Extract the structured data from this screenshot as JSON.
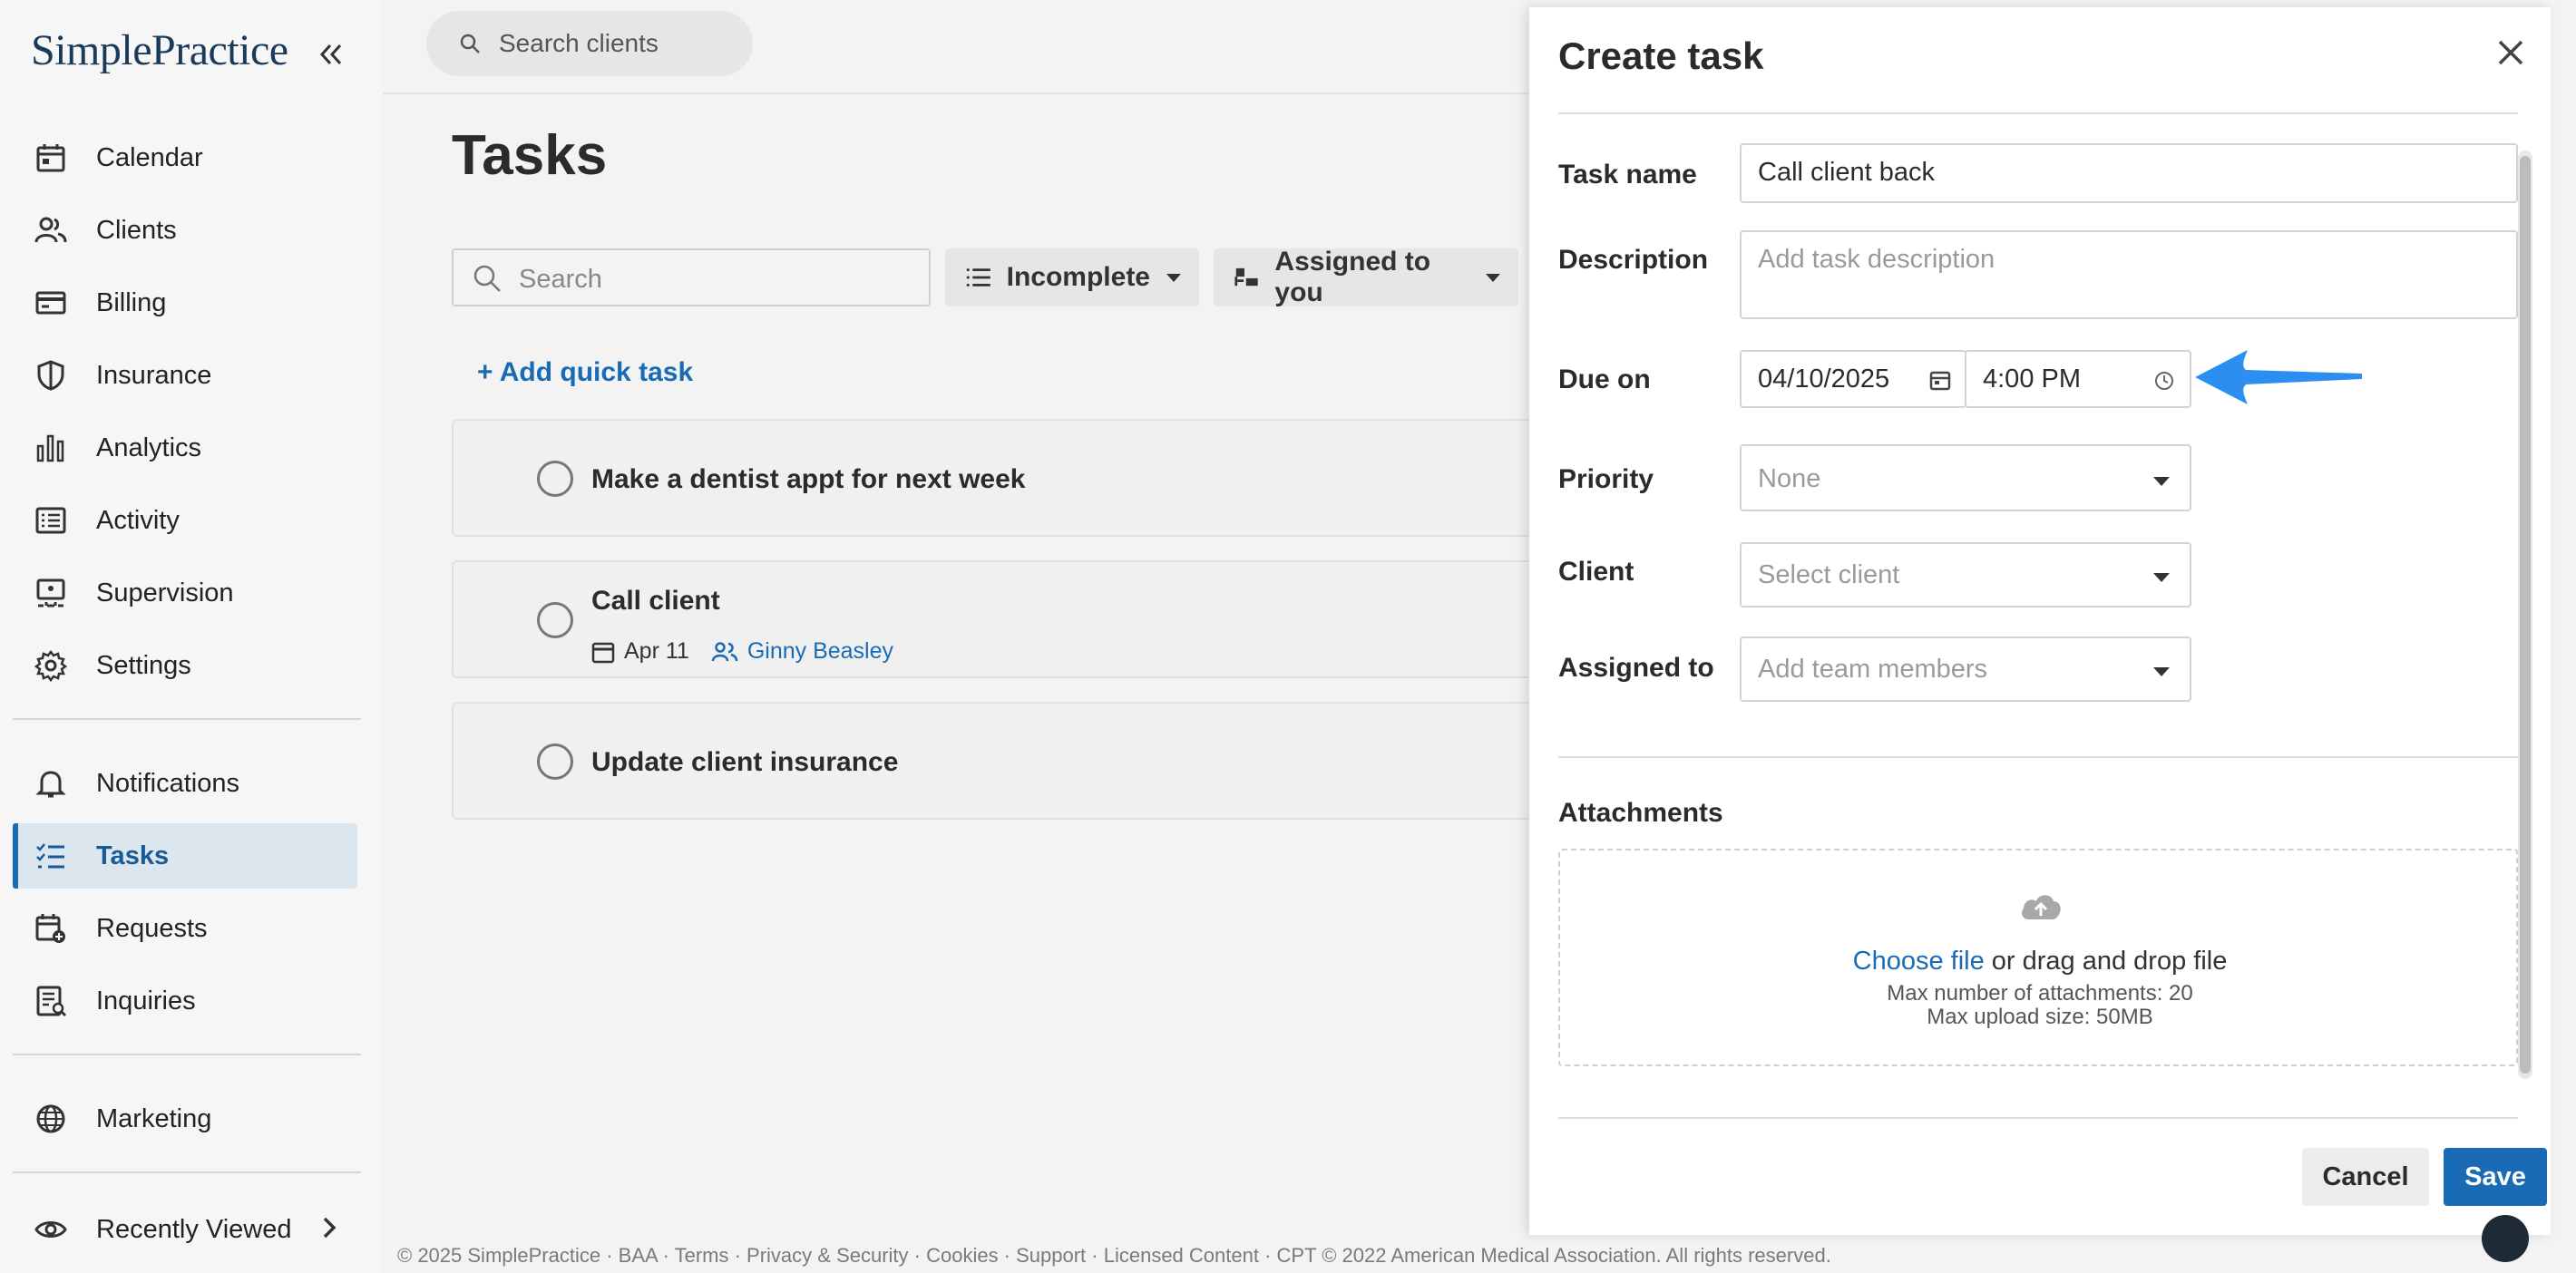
{
  "app": {
    "logo_text": "SimplePractice"
  },
  "sidebar": {
    "items": [
      {
        "label": "Calendar",
        "icon": "calendar-icon"
      },
      {
        "label": "Clients",
        "icon": "clients-icon"
      },
      {
        "label": "Billing",
        "icon": "billing-icon"
      },
      {
        "label": "Insurance",
        "icon": "shield-icon"
      },
      {
        "label": "Analytics",
        "icon": "analytics-icon"
      },
      {
        "label": "Activity",
        "icon": "activity-icon"
      },
      {
        "label": "Supervision",
        "icon": "supervision-icon"
      },
      {
        "label": "Settings",
        "icon": "gear-icon"
      },
      {
        "label": "Notifications",
        "icon": "bell-icon"
      },
      {
        "label": "Tasks",
        "icon": "tasks-icon",
        "active": true
      },
      {
        "label": "Requests",
        "icon": "requests-icon"
      },
      {
        "label": "Inquiries",
        "icon": "inquiries-icon"
      },
      {
        "label": "Marketing",
        "icon": "globe-icon"
      },
      {
        "label": "Recently Viewed",
        "icon": "eye-icon"
      }
    ]
  },
  "topbar": {
    "search_placeholder": "Search clients"
  },
  "tasks_page": {
    "title": "Tasks",
    "search_placeholder": "Search",
    "filter_status": "Incomplete",
    "filter_assignee": "Assigned to you",
    "add_quick_task": "+ Add quick task",
    "tasks": [
      {
        "title": "Make a dentist appt for next week"
      },
      {
        "title": "Call client",
        "due": "Apr 11",
        "client": "Ginny Beasley"
      },
      {
        "title": "Update client insurance"
      }
    ]
  },
  "create_task": {
    "title": "Create task",
    "task_name_label": "Task name",
    "task_name_value": "Call client back",
    "description_label": "Description",
    "description_placeholder": "Add task description",
    "due_on_label": "Due on",
    "due_date": "04/10/2025",
    "due_time": "4:00 PM",
    "priority_label": "Priority",
    "priority_value": "None",
    "client_label": "Client",
    "client_placeholder": "Select client",
    "assigned_label": "Assigned to",
    "assigned_placeholder": "Add team members",
    "attachments_label": "Attachments",
    "choose_file": "Choose file",
    "drag_drop": " or drag and drop file",
    "max_attachments": "Max number of attachments: 20",
    "max_upload": "Max upload size: 50MB",
    "cancel": "Cancel",
    "save": "Save"
  },
  "footer": {
    "text": "© 2025 SimplePractice · BAA · Terms · Privacy & Security · Cookies · Support · Licensed Content · CPT © 2022 American Medical Association. All rights reserved."
  },
  "colors": {
    "accent": "#1a6bb5",
    "arrow": "#2b8ef0",
    "active_bg": "#dbe6ef"
  }
}
